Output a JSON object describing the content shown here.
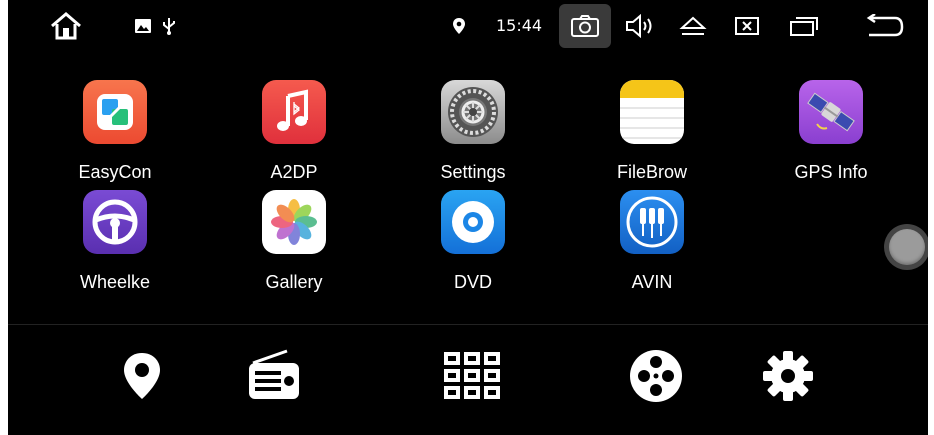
{
  "status_bar": {
    "time": "15:44",
    "icons": [
      "home-icon",
      "image-notification-icon",
      "usb-icon",
      "location-icon",
      "screenshot-icon",
      "volume-icon",
      "eject-icon",
      "close-window-icon",
      "recent-apps-icon",
      "back-icon"
    ]
  },
  "apps": [
    {
      "label": "EasyCon",
      "icon": "easyconnect-icon"
    },
    {
      "label": "A2DP",
      "icon": "music-bluetooth-icon"
    },
    {
      "label": "Settings",
      "icon": "settings-gear-icon"
    },
    {
      "label": "FileBrow",
      "icon": "file-browser-icon"
    },
    {
      "label": "GPS Info",
      "icon": "satellite-icon"
    },
    {
      "label": "Wheelke",
      "icon": "steering-wheel-icon"
    },
    {
      "label": "Gallery",
      "icon": "gallery-flower-icon"
    },
    {
      "label": "DVD",
      "icon": "disc-icon"
    },
    {
      "label": "AVIN",
      "icon": "av-input-icon"
    }
  ],
  "dock": [
    "navigation-pin-icon",
    "radio-icon",
    "app-drawer-grid-icon",
    "media-reel-icon",
    "settings-cog-icon"
  ],
  "colors": {
    "background": "#000000",
    "text": "#ffffff",
    "easycon": "#f0623f",
    "a2dp": "#f04040",
    "dvd": "#1a8de8",
    "wheelkey": "#6a3fc4",
    "gps": "#a855e0"
  }
}
